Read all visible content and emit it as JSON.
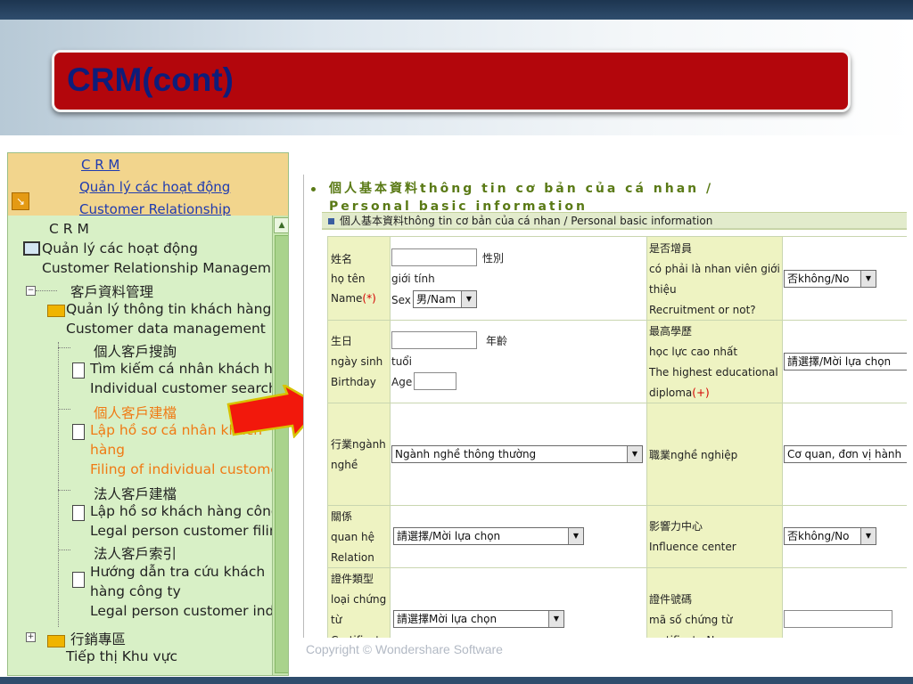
{
  "slide_title": "CRM(cont)",
  "copyright": "Copyright © Wondershare Software",
  "tree_header": {
    "link1": "C R M",
    "link2": "Quản lý các hoạt động",
    "link3": "Customer Relationship"
  },
  "tree": [
    "C R M",
    "Quản lý các hoạt động",
    "Customer Relationship Managem",
    "客戶資料管理",
    "Quản lý thông tin khách hàng",
    "Customer data management",
    "個人客戶搜詢",
    "Tìm kiếm cá nhân khách hà",
    "Individual customer search",
    "個人客戶建檔",
    "Lập hồ sơ cá nhân khách",
    "hàng",
    "Filing of individual custome",
    "法人客戶建檔",
    "Lập hồ sơ khách hàng công",
    "Legal person customer filin",
    "法人客戶索引",
    "Hướng dẫn tra cứu khách",
    "hàng công ty",
    "Legal person customer ind",
    "行銷專區",
    "Tiếp thị Khu vực"
  ],
  "form": {
    "title_line1": "個人基本資料thông tin cơ bản của cá nhan /",
    "title_line2": "Personal basic information",
    "bar_label": "個人基本資料thông tin cơ bản của cá nhan    /    Personal basic information",
    "name": {
      "l1": "姓名",
      "l2": "họ tên",
      "l3": "Name",
      "req": "(*)"
    },
    "sex": {
      "cn": "性別",
      "vi": "giới tính",
      "en": "Sex",
      "value": "男/Nam"
    },
    "recruit": {
      "l1": "是否增員",
      "l2": "có phải là nhan viên giới",
      "l3": "thiệu",
      "l4": "Recruitment or not?",
      "value": "否không/No"
    },
    "birthday": {
      "l1": "生日",
      "l2": "ngày sinh",
      "l3": "Birthday"
    },
    "age": {
      "cn": "年齡",
      "vi": "tuổi",
      "en": "Age"
    },
    "education": {
      "l1": "最高學歷",
      "l2": "học lực cao nhất",
      "l3": "The highest educational",
      "l4": "diploma",
      "req": "(+)",
      "value": "請選擇/Mời lựa chọn"
    },
    "industry": {
      "l1": "行業ngành",
      "l2": "nghề",
      "value": "Ngành nghề thông thường"
    },
    "occupation": {
      "label": "職業nghề nghiệp",
      "value": "Cơ quan, đơn vị hành"
    },
    "relation": {
      "l1": "關係",
      "l2": "quan hệ",
      "l3": "Relation",
      "value": "請選擇/Mời lựa chọn"
    },
    "influence": {
      "l1": "影響力中心",
      "l2": "Influence center",
      "value": "否không/No"
    },
    "certtype": {
      "l1": "證件類型",
      "l2": "loại chứng",
      "l3": "từ",
      "l4": "Certificate",
      "value": "請選擇Mời lựa chọn"
    },
    "certno": {
      "l1": "證件號碼",
      "l2": "mã số chứng từ",
      "l3": "certificate No"
    }
  }
}
